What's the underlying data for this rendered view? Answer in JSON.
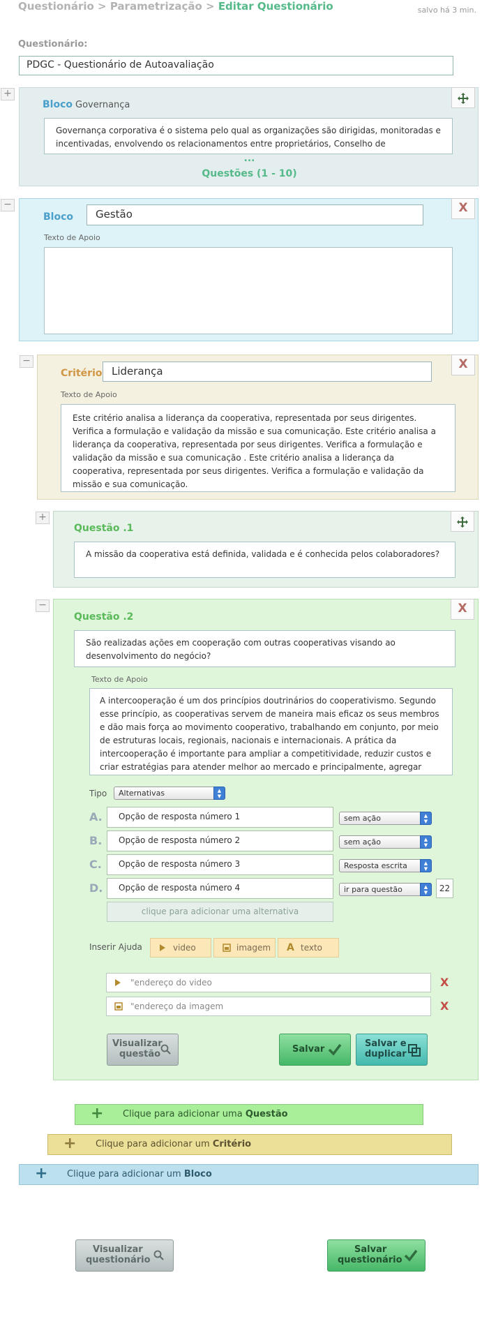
{
  "breadcrumb": {
    "item1": "Questionário",
    "sep1": ">",
    "item2": "Parametrização",
    "sep2": ">",
    "current": "Editar Questionário"
  },
  "saved_status": "salvo há 3 min.",
  "questionario": {
    "label": "Questionário:",
    "value": "PDGC - Questionário de Autoavaliação"
  },
  "block1": {
    "toggle": "+",
    "label": "Bloco",
    "name": "Governança",
    "text": "Governança corporativa é o sistema pelo qual as organizações são dirigidas, monitoradas e incentivadas, envolvendo os relacionamentos entre proprietários, Conselho  de",
    "ellipsis": "...",
    "questions_link": "Questões (1 - 10)"
  },
  "block2": {
    "toggle": "−",
    "label": "Bloco",
    "name_value": "Gestão",
    "support_label": "Texto de Apoio",
    "support_text": "",
    "close": "X"
  },
  "criterio": {
    "toggle": "−",
    "label": "Critério",
    "name_value": "Liderança",
    "support_label": "Texto de Apoio",
    "support_text": "Este critério analisa a liderança da cooperativa, representada por seus dirigentes. Verifica a formulação e validação da missão e sua comunicação. Este critério analisa a liderança da cooperativa, representada por seus dirigentes. Verifica a formulação e validação da missão e sua comunicação . Este critério analisa a liderança da cooperativa, representada por seus dirigentes. Verifica a formulação e validação da missão e sua comunicação.",
    "close": "X"
  },
  "questao1": {
    "toggle": "+",
    "label": "Questão .1",
    "text": "A  missão da cooperativa está definida, validada e é conhecida pelos colaboradores?"
  },
  "questao2": {
    "toggle": "−",
    "label": "Questão .2",
    "close": "X",
    "text": "São realizadas ações em cooperação com outras cooperativas visando ao desenvolvimento do negócio?",
    "support_label": "Texto de Apoio",
    "support_text": "A intercooperação é um dos princípios doutrinários do cooperativismo. Segundo esse princípio, as cooperativas servem de maneira mais eficaz os seus membros e dão mais força ao movimento cooperativo, trabalhando em  conjunto, por meio de estruturas locais, regionais, nacionais e internacionais. A prática da intercooperação é importante para  ampliar a competitividade, reduzir custos e criar estratégias para atender melhor ao mercado e principalmente, agregar valor aos cooperados e as suas atividades.",
    "tipo_label": "Tipo",
    "tipo_value": "Alternativas",
    "alternatives": [
      {
        "letter": "A.",
        "text": "Opção de resposta número 1",
        "action": "sem ação"
      },
      {
        "letter": "B.",
        "text": "Opção de resposta número 2",
        "action": "sem ação"
      },
      {
        "letter": "C.",
        "text": "Opção de resposta número 3",
        "action": "Resposta escrita"
      },
      {
        "letter": "D.",
        "text": "Opção de resposta número 4",
        "action": "ir para questão",
        "target": "22"
      }
    ],
    "add_alternative": "clique para adicionar uma alternativa",
    "help_label": "Inserir Ajuda",
    "help_buttons": {
      "video": "video",
      "image": "imagem",
      "text": "texto"
    },
    "video_placeholder": "\"endereço do video",
    "image_placeholder": "\"endereço da imagem",
    "remove": "X",
    "preview_button": {
      "line1": "Visualizar",
      "line2": "questão"
    },
    "save_button": "Salvar",
    "save_duplicate_button": {
      "line1": "Salvar e",
      "line2": "duplicar"
    }
  },
  "add_bars": {
    "question": {
      "prefix": "Clique para adicionar uma ",
      "bold": "Questão"
    },
    "criterion": {
      "prefix": "Clique para adicionar um  ",
      "bold": "Critério"
    },
    "block": {
      "prefix": "Clique para adicionar um ",
      "bold": "Bloco"
    }
  },
  "footer": {
    "preview": {
      "line1": "Visualizar",
      "line2": "questionário"
    },
    "save": {
      "line1": "Salvar",
      "line2": "questionário"
    }
  },
  "colors": {
    "accent_green": "#55b98a",
    "bloco_blue": "#4a9fcc",
    "criterio_orange": "#d19645",
    "questao_green": "#5aba5a"
  }
}
